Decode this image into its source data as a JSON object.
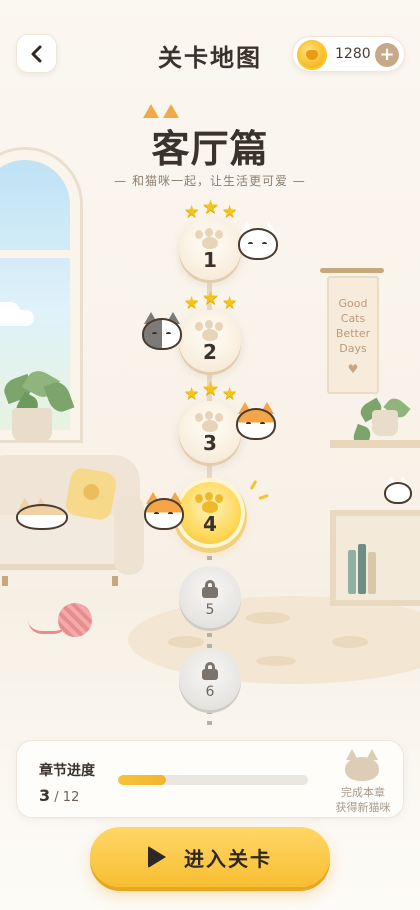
{
  "header": {
    "title": "关卡地图",
    "coins": "1280",
    "back_icon": "chevron-left-icon",
    "add_icon": "plus-icon",
    "add_label": "+"
  },
  "chapter": {
    "name": "客厅篇",
    "subtitle": "— 和猫咪一起，让生活更可爱 —"
  },
  "banner": {
    "lines": [
      "Good",
      "Cats",
      "Better",
      "Days"
    ],
    "heart": "♥"
  },
  "levels": [
    {
      "number": "1",
      "state": "completed",
      "stars": 3
    },
    {
      "number": "2",
      "state": "completed",
      "stars": 3
    },
    {
      "number": "3",
      "state": "completed",
      "stars": 3
    },
    {
      "number": "4",
      "state": "current",
      "stars": 0
    },
    {
      "number": "5",
      "state": "locked",
      "stars": 0
    },
    {
      "number": "6",
      "state": "locked",
      "stars": 0
    }
  ],
  "progress": {
    "label": "章节进度",
    "current": "3",
    "total": "/ 12",
    "fraction": 0.25,
    "reward_line1": "完成本章",
    "reward_line2": "获得新猫咪"
  },
  "enter_button": {
    "label": "进入关卡",
    "icon": "play-icon"
  },
  "colors": {
    "accent": "#f8be33",
    "background": "#faf6ef",
    "text": "#3b322b",
    "star": "#f5c419"
  }
}
